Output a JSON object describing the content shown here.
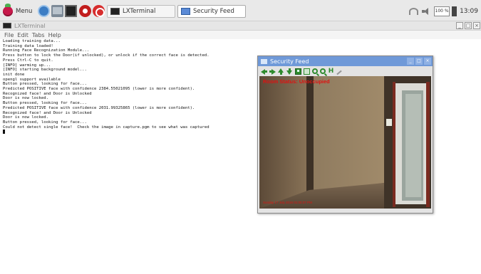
{
  "taskbar": {
    "menu_label": "Menu",
    "tasks": [
      {
        "label": "LXTerminal"
      },
      {
        "label": "Security Feed"
      }
    ],
    "cpu_label": "100 %",
    "clock": "13:09"
  },
  "terminal": {
    "title": "LXTerminal",
    "menu": [
      "File",
      "Edit",
      "Tabs",
      "Help"
    ],
    "lines": [
      "Loading training data...",
      "Training data loaded!",
      "Running Face Recognization Module...",
      "Press button to lock the Door(if unlocked), or unlock if the correct face is detected.",
      "Press Ctrl-C to quit.",
      "[INFO] warming up...",
      "[INFO] starting background model...",
      "init done",
      "opengl support available",
      "Button pressed, looking for face...",
      "Predicted POSITIVE face with confidence 2384.55021095 (lower is more confident).",
      "Recognized face! and Door is Unlocked",
      "Door is now locked.",
      "Button pressed, looking for face...",
      "Predicted POSITIVE face with confidence 2031.99325865 (lower is more confident).",
      "Recognized face! and Door is Unlocked",
      "Door is now locked.",
      "Button pressed, looking for face...",
      "Could not detect single face!  Check the image in capture.pgm to see what was captured"
    ]
  },
  "feed": {
    "title": "Security Feed",
    "status_text": "Room Status: Unoccupied",
    "timestamp": "Sunday 17 July 2016 01:00:37 PM",
    "toolbar_icons": [
      "arrow-left-icon",
      "arrow-right-icon",
      "arrow-up-icon",
      "arrow-down-icon",
      "save-icon",
      "properties-icon",
      "zoom-in-icon",
      "zoom-out-icon",
      "hold-icon",
      "pin-icon"
    ]
  },
  "colors": {
    "feed_title_bg": "#6f99d8",
    "status_red": "#e01010",
    "toolbar_green": "#2e8b2e"
  }
}
